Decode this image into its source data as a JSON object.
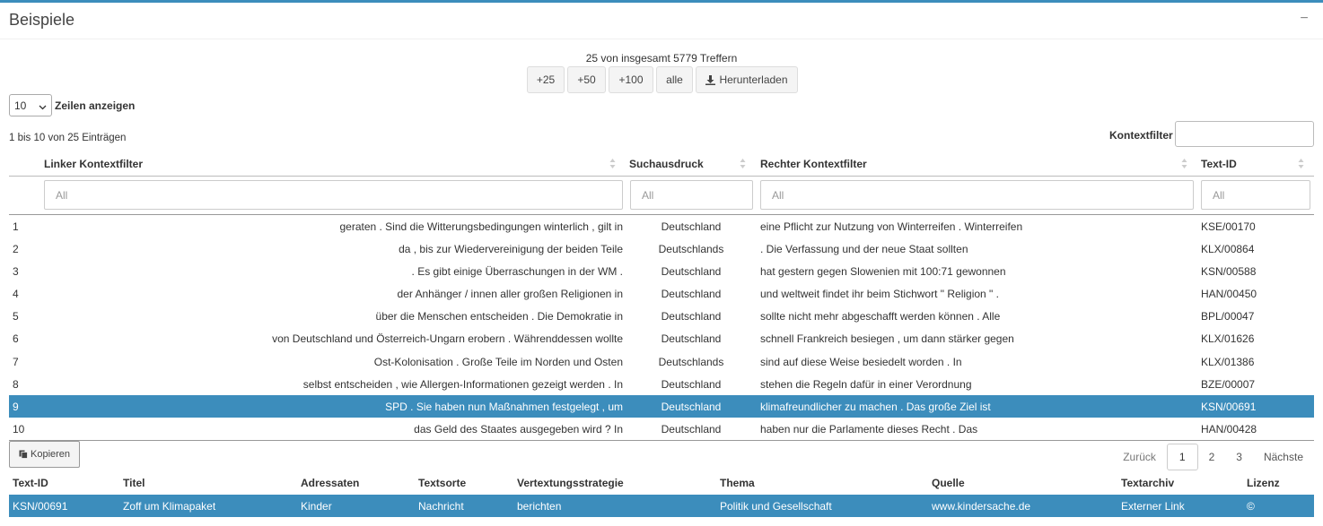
{
  "panel": {
    "title": "Beispiele",
    "collapse_symbol": "−"
  },
  "hits_text": "25 von insgesamt 5779 Treffern",
  "load_buttons": [
    "+25",
    "+50",
    "+100",
    "alle"
  ],
  "download_label": "Herunterladen",
  "page_length": {
    "value": "10",
    "label": "Zeilen anzeigen"
  },
  "info_text": "1 bis 10 von 25 Einträgen",
  "context_filter": {
    "label": "Kontextfilter",
    "value": ""
  },
  "columns": {
    "left": "Linker Kontextfilter",
    "keyword": "Suchausdruck",
    "right": "Rechter Kontextfilter",
    "text_id": "Text-ID"
  },
  "filter_placeholder": "All",
  "rows": [
    {
      "n": "1",
      "left": "geraten . Sind die Witterungsbedingungen winterlich , gilt in",
      "kw": "Deutschland",
      "right": "eine Pflicht zur Nutzung von Winterreifen . Winterreifen",
      "id": "KSE/00170"
    },
    {
      "n": "2",
      "left": "da , bis zur Wiedervereinigung der beiden Teile",
      "kw": "Deutschlands",
      "right": ". Die Verfassung und der neue Staat sollten",
      "id": "KLX/00864"
    },
    {
      "n": "3",
      "left": ". Es gibt einige Überraschungen in der WM .",
      "kw": "Deutschland",
      "right": "hat gestern gegen Slowenien mit 100:71 gewonnen",
      "id": "KSN/00588"
    },
    {
      "n": "4",
      "left": "der Anhänger / innen aller großen Religionen in",
      "kw": "Deutschland",
      "right": "und weltweit findet ihr beim Stichwort \" Religion \" .",
      "id": "HAN/00450"
    },
    {
      "n": "5",
      "left": "über die Menschen entscheiden . Die Demokratie in",
      "kw": "Deutschland",
      "right": "sollte nicht mehr abgeschafft werden können . Alle",
      "id": "BPL/00047"
    },
    {
      "n": "6",
      "left": "von Deutschland und Österreich-Ungarn erobern . Währenddessen wollte",
      "kw": "Deutschland",
      "right": "schnell Frankreich besiegen , um dann stärker gegen",
      "id": "KLX/01626"
    },
    {
      "n": "7",
      "left": "Ost-Kolonisation . Große Teile im Norden und Osten",
      "kw": "Deutschlands",
      "right": "sind auf diese Weise besiedelt worden . In",
      "id": "KLX/01386"
    },
    {
      "n": "8",
      "left": "selbst entscheiden , wie Allergen-Informationen gezeigt werden . In",
      "kw": "Deutschland",
      "right": "stehen die Regeln dafür in einer Verordnung",
      "id": "BZE/00007"
    },
    {
      "n": "9",
      "left": "SPD . Sie haben nun Maßnahmen festgelegt , um",
      "kw": "Deutschland",
      "right": "klimafreundlicher zu machen . Das große Ziel ist",
      "id": "KSN/00691",
      "selected": true
    },
    {
      "n": "10",
      "left": "das Geld des Staates ausgegeben wird ? In",
      "kw": "Deutschland",
      "right": "haben nur die Parlamente dieses Recht . Das",
      "id": "HAN/00428"
    }
  ],
  "copy_label": "Kopieren",
  "pagination": {
    "prev": "Zurück",
    "pages": [
      "1",
      "2",
      "3"
    ],
    "active": "1",
    "next": "Nächste"
  },
  "meta_columns": {
    "text_id": "Text-ID",
    "title": "Titel",
    "audience": "Adressaten",
    "type": "Textsorte",
    "strategy": "Vertextungsstrategie",
    "topic": "Thema",
    "source": "Quelle",
    "archive": "Textarchiv",
    "license": "Lizenz"
  },
  "meta_row": {
    "text_id": "KSN/00691",
    "title": "Zoff um Klimapaket",
    "audience": "Kinder",
    "type": "Nachricht",
    "strategy": "berichten",
    "topic": "Politik und Gesellschaft",
    "source": "www.kindersache.de",
    "archive": "Externer Link",
    "license": "©"
  },
  "colors": {
    "accent": "#3c8dbc"
  },
  "icons": {
    "download": "download-icon",
    "copy": "copy-icon",
    "collapse": "minus-icon",
    "sort": "sort-icon",
    "dropdown": "chevron-down-icon"
  }
}
